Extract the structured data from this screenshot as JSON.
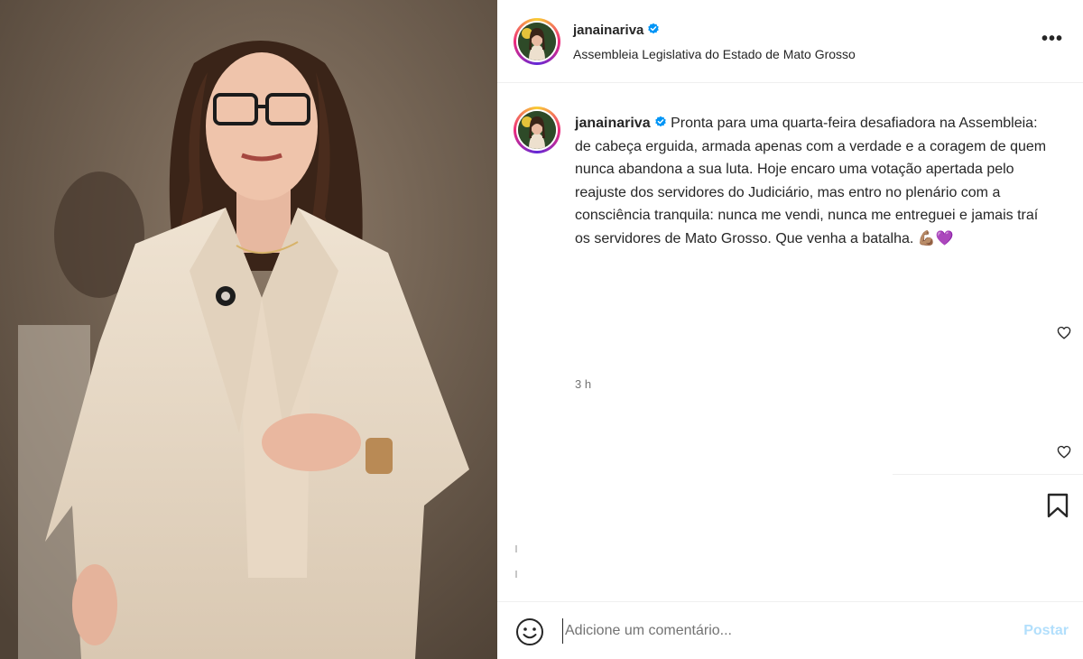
{
  "post": {
    "username": "janainariva",
    "location": "Assembleia Legislativa do Estado de Mato Grosso",
    "caption": "Pronta para uma quarta-feira desafiadora na Assembleia: de cabeça erguida, armada apenas com a verdade e a coragem de quem nunca abandona a sua luta. Hoje encaro uma votação apertada pelo reajuste dos servidores do Judiciário, mas entro no plenário com a consciência tranquila: nunca me vendi, nunca me entreguei e jamais traí os servidores de Mato Grosso. Que venha a batalha. 💪🏽💜",
    "time": "3 h"
  },
  "header": {
    "more_label": "•••"
  },
  "comment": {
    "placeholder": "Adicione um comentário...",
    "post_label": "Postar"
  },
  "colors": {
    "verified": "#0095f6",
    "post_button": "#b2dffc",
    "text": "#262626",
    "muted": "#737373"
  },
  "icons": [
    "verified-badge-icon",
    "more-options-icon",
    "heart-icon",
    "bookmark-icon",
    "emoji-icon"
  ]
}
